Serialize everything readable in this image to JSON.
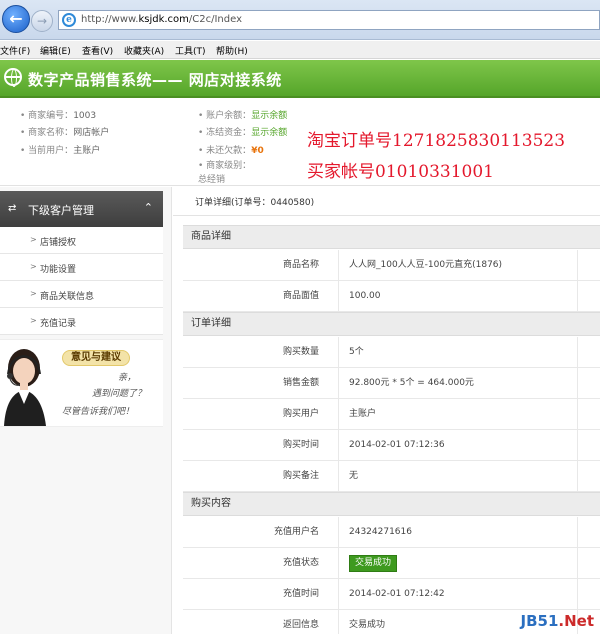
{
  "browser": {
    "url_prefix": "http://www.",
    "url_domain": "ksjdk.com",
    "url_path": "/C2c/Index",
    "menu": [
      "文件(F)",
      "编辑(E)",
      "查看(V)",
      "收藏夹(A)",
      "工具(T)",
      "帮助(H)"
    ]
  },
  "header": {
    "title": "数字产品销售系统—— 网店对接系统"
  },
  "account": {
    "merchant_no_label": "商家编号：",
    "merchant_no": "1003",
    "merchant_name_label": "商家名称：",
    "merchant_name": "网店帐户",
    "current_user_label": "当前用户：",
    "current_user": "主账户",
    "balance_label": "账户余额：",
    "balance": "显示余额",
    "frozen_label": "冻结资金：",
    "frozen": "显示余额",
    "debt_label": "未还欠款：",
    "debt": "¥0",
    "level_label": "商家级别：",
    "level": "总经销"
  },
  "overlay": {
    "taobao_order": "淘宝订单号1271825830113523",
    "buyer_account": "买家帐号01010331001"
  },
  "sidebar": {
    "section_title": "下级客户管理",
    "items": [
      {
        "label": "店铺授权"
      },
      {
        "label": "功能设置"
      },
      {
        "label": "商品关联信息"
      },
      {
        "label": "充值记录"
      }
    ],
    "feedback": {
      "badge": "意见与建议",
      "line1": "亲，",
      "line2": "遇到问题了？",
      "line3": "尽管告诉我们吧！"
    }
  },
  "order": {
    "detail_title": "订单详细(订单号：0440580)",
    "sections": {
      "product": "商品详细",
      "order": "订单详细",
      "purchase": "购买内容"
    },
    "product_rows": [
      {
        "label": "商品名称",
        "value": "人人网_100人人豆-100元直充(1876)"
      },
      {
        "label": "商品面值",
        "value": "100.00"
      }
    ],
    "order_rows": [
      {
        "label": "购买数量",
        "value": "5个"
      },
      {
        "label": "销售金额",
        "value": "92.800元 * 5个 = 464.000元"
      },
      {
        "label": "购买用户",
        "value": "主账户"
      },
      {
        "label": "购买时间",
        "value": "2014-02-01 07:12:36"
      },
      {
        "label": "购买备注",
        "value": "无"
      }
    ],
    "purchase_rows": [
      {
        "label": "充值用户名",
        "value": "24324271616"
      },
      {
        "label": "充值状态",
        "value": "交易成功"
      },
      {
        "label": "充值时间",
        "value": "2014-02-01 07:12:42"
      },
      {
        "label": "返回信息",
        "value": "交易成功"
      }
    ]
  },
  "watermark": {
    "a": "JB51",
    "b": ".Net"
  }
}
